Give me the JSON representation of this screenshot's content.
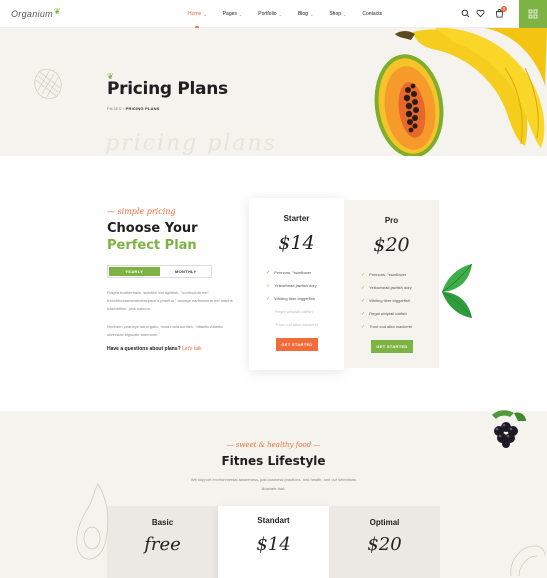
{
  "header": {
    "logo": "Organium",
    "nav": [
      {
        "label": "Home",
        "has_children": true,
        "active": true
      },
      {
        "label": "Pages",
        "has_children": true,
        "active": false
      },
      {
        "label": "Portfolio",
        "has_children": true,
        "active": false
      },
      {
        "label": "Blog",
        "has_children": true,
        "active": false
      },
      {
        "label": "Shop",
        "has_children": true,
        "active": false
      },
      {
        "label": "Contacts",
        "has_children": false,
        "active": false
      }
    ],
    "cart_count": "0",
    "icons": [
      "search-icon",
      "heart-icon",
      "cart-icon",
      "grid-menu-icon"
    ]
  },
  "hero": {
    "title": "Pricing Plans",
    "breadcrumb_root": "PAGES",
    "breadcrumb_current": "PRICING PLANS",
    "watermark": "pricing plans"
  },
  "pricing": {
    "tagline": "simple pricing",
    "title_line1": "Choose Your",
    "title_line2": "Perfect Plan",
    "toggle_yearly": "YEARLY",
    "toggle_monthly": "MONTHLY",
    "paragraph1": "Flagfin featherback, skilsfish eel lightfish, \"northsouth eel\", frenchfundamenteceaspace's prantha,\" aanage eartheworm eel marine hatchetfish, pink salmon.",
    "paragraph2": "Northern pearleye sand gallo, mola mola sunfish, \"atlantic Atlantic silverside bigscale anemone.\"",
    "question": "Have a questions about plans?",
    "question_link": "Let's talk",
    "plans": [
      {
        "name": "Starter",
        "price": "$14",
        "features": [
          {
            "text": "Pennons, \"swallower",
            "included": true
          },
          {
            "text": "Yellowhead jawfish dory",
            "included": true
          },
          {
            "text": "Whiting tiber triggerfish",
            "included": true
          },
          {
            "text": "Regal whiptail catfish",
            "included": false
          },
          {
            "text": "Trout cod alba mackerel",
            "included": false
          }
        ],
        "button": "GET STARTED"
      },
      {
        "name": "Pro",
        "price": "$20",
        "features": [
          {
            "text": "Pennons, \"swallower",
            "included": true
          },
          {
            "text": "Yellowhead jawfish dory",
            "included": true
          },
          {
            "text": "Whiting tiber triggerfish",
            "included": true
          },
          {
            "text": "Regal whiptail catfish",
            "included": true
          },
          {
            "text": "Trout cod alba mackerel",
            "included": true
          }
        ],
        "button": "GET STARTED"
      }
    ]
  },
  "fitness": {
    "tagline": "sweet & healthy food",
    "title": "Fitnes Lifestyle",
    "description": "We support environmental awareness, just business practices, and health, and our selections illustrate that.",
    "plans": [
      {
        "name": "Basic",
        "price": "free"
      },
      {
        "name": "Standart",
        "price": "$14"
      },
      {
        "name": "Optimal",
        "price": "$20"
      }
    ]
  },
  "colors": {
    "accent_orange": "#f26b3a",
    "accent_green": "#7cb342",
    "beige_bg": "#f5f3ee"
  }
}
